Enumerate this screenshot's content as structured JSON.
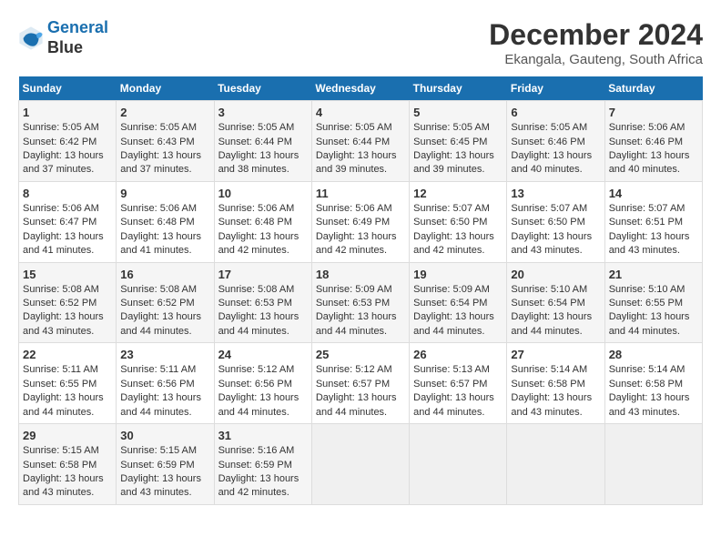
{
  "logo": {
    "line1": "General",
    "line2": "Blue"
  },
  "title": "December 2024",
  "subtitle": "Ekangala, Gauteng, South Africa",
  "days_header": [
    "Sunday",
    "Monday",
    "Tuesday",
    "Wednesday",
    "Thursday",
    "Friday",
    "Saturday"
  ],
  "weeks": [
    [
      {
        "day": "1",
        "sunrise": "Sunrise: 5:05 AM",
        "sunset": "Sunset: 6:42 PM",
        "daylight": "Daylight: 13 hours and 37 minutes."
      },
      {
        "day": "2",
        "sunrise": "Sunrise: 5:05 AM",
        "sunset": "Sunset: 6:43 PM",
        "daylight": "Daylight: 13 hours and 37 minutes."
      },
      {
        "day": "3",
        "sunrise": "Sunrise: 5:05 AM",
        "sunset": "Sunset: 6:44 PM",
        "daylight": "Daylight: 13 hours and 38 minutes."
      },
      {
        "day": "4",
        "sunrise": "Sunrise: 5:05 AM",
        "sunset": "Sunset: 6:44 PM",
        "daylight": "Daylight: 13 hours and 39 minutes."
      },
      {
        "day": "5",
        "sunrise": "Sunrise: 5:05 AM",
        "sunset": "Sunset: 6:45 PM",
        "daylight": "Daylight: 13 hours and 39 minutes."
      },
      {
        "day": "6",
        "sunrise": "Sunrise: 5:05 AM",
        "sunset": "Sunset: 6:46 PM",
        "daylight": "Daylight: 13 hours and 40 minutes."
      },
      {
        "day": "7",
        "sunrise": "Sunrise: 5:06 AM",
        "sunset": "Sunset: 6:46 PM",
        "daylight": "Daylight: 13 hours and 40 minutes."
      }
    ],
    [
      {
        "day": "8",
        "sunrise": "Sunrise: 5:06 AM",
        "sunset": "Sunset: 6:47 PM",
        "daylight": "Daylight: 13 hours and 41 minutes."
      },
      {
        "day": "9",
        "sunrise": "Sunrise: 5:06 AM",
        "sunset": "Sunset: 6:48 PM",
        "daylight": "Daylight: 13 hours and 41 minutes."
      },
      {
        "day": "10",
        "sunrise": "Sunrise: 5:06 AM",
        "sunset": "Sunset: 6:48 PM",
        "daylight": "Daylight: 13 hours and 42 minutes."
      },
      {
        "day": "11",
        "sunrise": "Sunrise: 5:06 AM",
        "sunset": "Sunset: 6:49 PM",
        "daylight": "Daylight: 13 hours and 42 minutes."
      },
      {
        "day": "12",
        "sunrise": "Sunrise: 5:07 AM",
        "sunset": "Sunset: 6:50 PM",
        "daylight": "Daylight: 13 hours and 42 minutes."
      },
      {
        "day": "13",
        "sunrise": "Sunrise: 5:07 AM",
        "sunset": "Sunset: 6:50 PM",
        "daylight": "Daylight: 13 hours and 43 minutes."
      },
      {
        "day": "14",
        "sunrise": "Sunrise: 5:07 AM",
        "sunset": "Sunset: 6:51 PM",
        "daylight": "Daylight: 13 hours and 43 minutes."
      }
    ],
    [
      {
        "day": "15",
        "sunrise": "Sunrise: 5:08 AM",
        "sunset": "Sunset: 6:52 PM",
        "daylight": "Daylight: 13 hours and 43 minutes."
      },
      {
        "day": "16",
        "sunrise": "Sunrise: 5:08 AM",
        "sunset": "Sunset: 6:52 PM",
        "daylight": "Daylight: 13 hours and 44 minutes."
      },
      {
        "day": "17",
        "sunrise": "Sunrise: 5:08 AM",
        "sunset": "Sunset: 6:53 PM",
        "daylight": "Daylight: 13 hours and 44 minutes."
      },
      {
        "day": "18",
        "sunrise": "Sunrise: 5:09 AM",
        "sunset": "Sunset: 6:53 PM",
        "daylight": "Daylight: 13 hours and 44 minutes."
      },
      {
        "day": "19",
        "sunrise": "Sunrise: 5:09 AM",
        "sunset": "Sunset: 6:54 PM",
        "daylight": "Daylight: 13 hours and 44 minutes."
      },
      {
        "day": "20",
        "sunrise": "Sunrise: 5:10 AM",
        "sunset": "Sunset: 6:54 PM",
        "daylight": "Daylight: 13 hours and 44 minutes."
      },
      {
        "day": "21",
        "sunrise": "Sunrise: 5:10 AM",
        "sunset": "Sunset: 6:55 PM",
        "daylight": "Daylight: 13 hours and 44 minutes."
      }
    ],
    [
      {
        "day": "22",
        "sunrise": "Sunrise: 5:11 AM",
        "sunset": "Sunset: 6:55 PM",
        "daylight": "Daylight: 13 hours and 44 minutes."
      },
      {
        "day": "23",
        "sunrise": "Sunrise: 5:11 AM",
        "sunset": "Sunset: 6:56 PM",
        "daylight": "Daylight: 13 hours and 44 minutes."
      },
      {
        "day": "24",
        "sunrise": "Sunrise: 5:12 AM",
        "sunset": "Sunset: 6:56 PM",
        "daylight": "Daylight: 13 hours and 44 minutes."
      },
      {
        "day": "25",
        "sunrise": "Sunrise: 5:12 AM",
        "sunset": "Sunset: 6:57 PM",
        "daylight": "Daylight: 13 hours and 44 minutes."
      },
      {
        "day": "26",
        "sunrise": "Sunrise: 5:13 AM",
        "sunset": "Sunset: 6:57 PM",
        "daylight": "Daylight: 13 hours and 44 minutes."
      },
      {
        "day": "27",
        "sunrise": "Sunrise: 5:14 AM",
        "sunset": "Sunset: 6:58 PM",
        "daylight": "Daylight: 13 hours and 43 minutes."
      },
      {
        "day": "28",
        "sunrise": "Sunrise: 5:14 AM",
        "sunset": "Sunset: 6:58 PM",
        "daylight": "Daylight: 13 hours and 43 minutes."
      }
    ],
    [
      {
        "day": "29",
        "sunrise": "Sunrise: 5:15 AM",
        "sunset": "Sunset: 6:58 PM",
        "daylight": "Daylight: 13 hours and 43 minutes."
      },
      {
        "day": "30",
        "sunrise": "Sunrise: 5:15 AM",
        "sunset": "Sunset: 6:59 PM",
        "daylight": "Daylight: 13 hours and 43 minutes."
      },
      {
        "day": "31",
        "sunrise": "Sunrise: 5:16 AM",
        "sunset": "Sunset: 6:59 PM",
        "daylight": "Daylight: 13 hours and 42 minutes."
      },
      null,
      null,
      null,
      null
    ]
  ]
}
